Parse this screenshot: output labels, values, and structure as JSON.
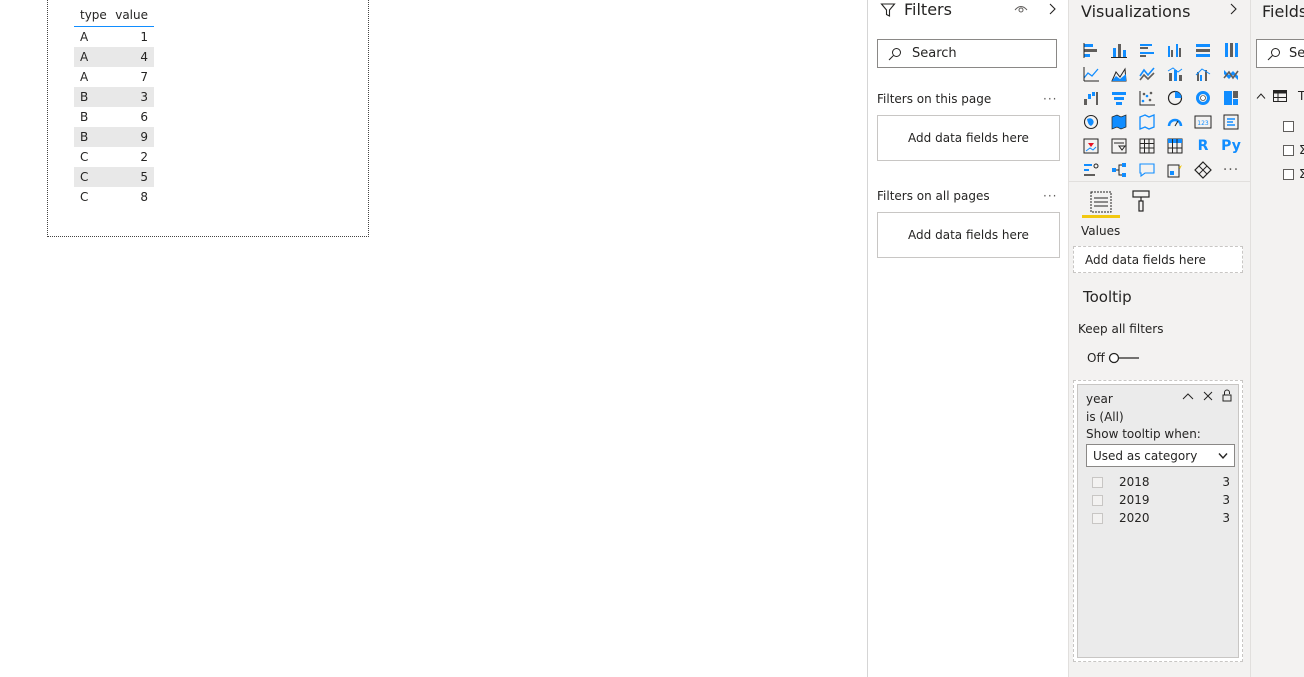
{
  "table": {
    "headers": [
      "type",
      "value"
    ],
    "rows": [
      [
        "A",
        "1"
      ],
      [
        "A",
        "4"
      ],
      [
        "A",
        "7"
      ],
      [
        "B",
        "3"
      ],
      [
        "B",
        "6"
      ],
      [
        "B",
        "9"
      ],
      [
        "C",
        "2"
      ],
      [
        "C",
        "5"
      ],
      [
        "C",
        "8"
      ]
    ]
  },
  "filters": {
    "title": "Filters",
    "search_placeholder": "Search",
    "on_this_page": "Filters on this page",
    "on_all_pages": "Filters on all pages",
    "add_fields": "Add data fields here",
    "more": "···"
  },
  "visualizations": {
    "title": "Visualizations",
    "more": "···",
    "values_label": "Values",
    "values_drop": "Add data fields here",
    "tooltip_title": "Tooltip",
    "keep_all_filters": "Keep all filters",
    "toggle_state": "Off",
    "r_label": "R",
    "py_label": "Py"
  },
  "filter_card": {
    "field": "year",
    "condition": "is (All)",
    "show_when": "Show tooltip when:",
    "selected": "Used as category",
    "options": [
      {
        "label": "2018",
        "count": "3"
      },
      {
        "label": "2019",
        "count": "3"
      },
      {
        "label": "2020",
        "count": "3"
      }
    ]
  },
  "fields": {
    "title": "Fields",
    "search_placeholder": "Se",
    "table_initial": "T",
    "sigma": "Σ"
  },
  "colors": {
    "accent": "#118dff",
    "yellow": "#f2c811"
  }
}
